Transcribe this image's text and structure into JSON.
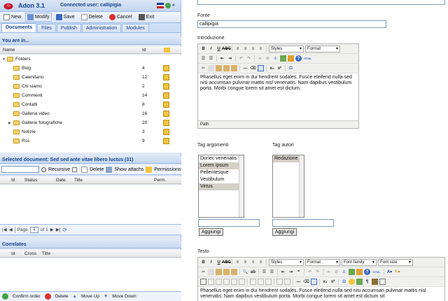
{
  "app": {
    "title": "Adon 3.1",
    "connected_user": "Connected user: callipigia",
    "accent": "#15428b",
    "flag_icon": "flag-icon",
    "collapse_label": "«"
  },
  "toolbar": {
    "new_label": "New",
    "modify_label": "Modify",
    "save_label": "Save",
    "delete_label": "Delete",
    "cancel_label": "Cancel",
    "exit_label": "Exit"
  },
  "tabs": [
    "Documents",
    "Files",
    "Publish",
    "Administration",
    "Modules"
  ],
  "you_are_in": {
    "header": "You are in...",
    "col_name": "Name",
    "col_id": "Id",
    "root": "Folders",
    "items": [
      {
        "name": "Blog",
        "id": "4"
      },
      {
        "name": "Calendario",
        "id": "12"
      },
      {
        "name": "Chi siamo",
        "id": "2"
      },
      {
        "name": "Commenti",
        "id": "14"
      },
      {
        "name": "Contatti",
        "id": "8"
      },
      {
        "name": "Galleria video",
        "id": "16"
      },
      {
        "name": "Gallerie fotografiche",
        "id": "20"
      },
      {
        "name": "Notizie",
        "id": "3"
      },
      {
        "name": "Rss",
        "id": "9"
      }
    ]
  },
  "selected_doc": {
    "header": "Selected document: Sed sed ante vitae libero luctus (31)",
    "recursive_label": "Recursive",
    "delete_label": "Delete",
    "show_attachs_label": "Show attachs",
    "permissions_label": "Permissions",
    "columns": [
      "Id",
      "Status",
      "Date",
      "Title",
      "Perm."
    ]
  },
  "pager": {
    "page_label": "Page",
    "page_value": "1",
    "of_label": "of 1"
  },
  "correlates": {
    "header": "Correlates",
    "columns": [
      "Id",
      "Cross",
      "Title"
    ]
  },
  "bottom": {
    "confirm_label": "Confirm order",
    "delete_label": "Delete",
    "move_up_label": "Move Up",
    "move_down_label": "Move Down"
  },
  "form": {
    "fonte_label": "Fonte",
    "fonte_value": "callipigia",
    "intro_label": "Introduzione",
    "intro_text": "Phasellus eget enim in dui hendrerit sodales. Fusce eleifend nulla sed nisi accumsan pulvinar mattis nisl venenatis. Nam dapibus vestibulum porta. Morbi congue lorem sit amet est dictum.",
    "path_label": "Path:",
    "styles_label": "Styles",
    "format_label": "Format",
    "font_family_label": "Font family",
    "font_size_label": "Font size",
    "tag_argomenti_label": "Tag argomenti",
    "tag_argomenti_options": [
      {
        "label": "Donec venenatis",
        "selected": false
      },
      {
        "label": "Lorem ipsum",
        "selected": true
      },
      {
        "label": "Pellentesque",
        "selected": false
      },
      {
        "label": "Vestibulum",
        "selected": false
      },
      {
        "label": "Virtus",
        "selected": true
      }
    ],
    "tag_autori_label": "Tag autori",
    "tag_autori_options": [
      {
        "label": "Redazione",
        "selected": true
      }
    ],
    "aggiungi_label": "Aggiungi",
    "testo_label": "Testo",
    "testo_text": "Phasellus eget enim in dui hendrerit sodales. Fusce eleifend nulla sed nisi accumsan pulvinar mattis nisl venenatis. Nam dapibus vestibulum porta. Morbi congue lorem sit amet est dictum sit"
  }
}
